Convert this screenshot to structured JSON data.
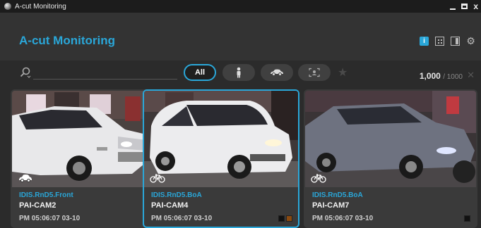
{
  "window": {
    "title": "A-cut Monitoring",
    "controls": {
      "minimize": "",
      "maximize": "",
      "close": "x"
    }
  },
  "header": {
    "title": "A-cut Monitoring",
    "icons": [
      "info-icon",
      "grid-icon",
      "panel-icon",
      "gear-icon"
    ]
  },
  "toolbar": {
    "search_placeholder": "",
    "filters": {
      "all_label": "All",
      "person_icon": "person-icon",
      "vehicle_icon": "vehicle-icon",
      "face_icon": "face-icon",
      "favorite_icon": "star-icon"
    },
    "count": "1,000",
    "count_total": "/ 1000",
    "clear_label": "✕"
  },
  "cards": [
    {
      "site": "IDIS.RnD5.Front",
      "camera": "PAI-CAM2",
      "time": "PM 05:06:07 03-10",
      "type_icon": "car-icon",
      "swatches": [
        "#111111",
        "#777777"
      ],
      "selected": false
    },
    {
      "site": "IDIS.RnD5.BoA",
      "camera": "PAI-CAM4",
      "time": "PM 05:06:07 03-10",
      "type_icon": "bicycle-icon",
      "swatches": [
        "#111111",
        "#8a4a10"
      ],
      "selected": true
    },
    {
      "site": "IDIS.RnD5.BoA",
      "camera": "PAI-CAM7",
      "time": "PM 05:06:07 03-10",
      "type_icon": "bicycle-icon",
      "swatches": [
        "#111111"
      ],
      "selected": false
    }
  ],
  "colors": {
    "accent": "#2aa7d9",
    "background": "#2b2b2b",
    "header": "#333333"
  }
}
